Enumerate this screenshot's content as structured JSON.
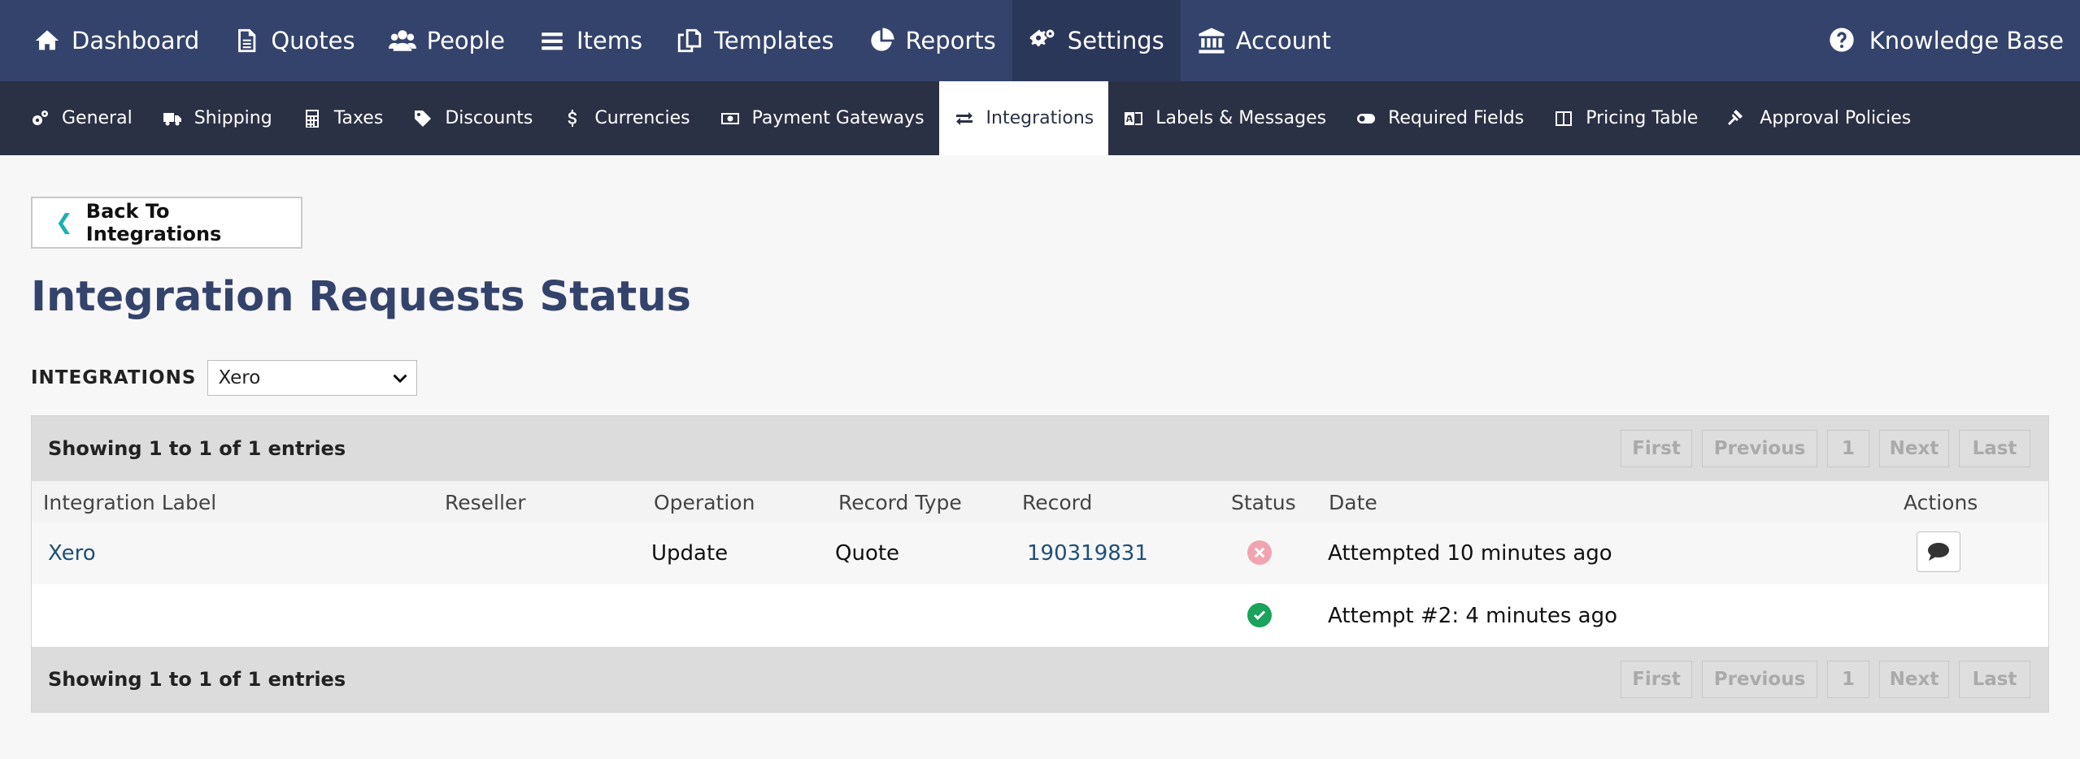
{
  "topnav": {
    "items": [
      {
        "label": "Dashboard",
        "icon": "home-icon"
      },
      {
        "label": "Quotes",
        "icon": "document-icon"
      },
      {
        "label": "People",
        "icon": "users-icon"
      },
      {
        "label": "Items",
        "icon": "list-icon"
      },
      {
        "label": "Templates",
        "icon": "copy-icon"
      },
      {
        "label": "Reports",
        "icon": "pie-chart-icon"
      },
      {
        "label": "Settings",
        "icon": "gears-icon"
      },
      {
        "label": "Account",
        "icon": "bank-icon"
      }
    ],
    "active": "Settings",
    "knowledge_base": "Knowledge Base"
  },
  "subnav": {
    "items": [
      {
        "label": "General",
        "icon": "gears-icon"
      },
      {
        "label": "Shipping",
        "icon": "truck-icon"
      },
      {
        "label": "Taxes",
        "icon": "calculator-icon"
      },
      {
        "label": "Discounts",
        "icon": "tag-icon"
      },
      {
        "label": "Currencies",
        "icon": "dollar-icon"
      },
      {
        "label": "Payment Gateways",
        "icon": "money-icon"
      },
      {
        "label": "Integrations",
        "icon": "exchange-icon"
      },
      {
        "label": "Labels & Messages",
        "icon": "language-icon"
      },
      {
        "label": "Required Fields",
        "icon": "toggle-icon"
      },
      {
        "label": "Pricing Table",
        "icon": "columns-icon"
      },
      {
        "label": "Approval Policies",
        "icon": "gavel-icon"
      }
    ],
    "active": "Integrations"
  },
  "main": {
    "back_label": "Back To Integrations",
    "title": "Integration Requests Status",
    "filter_label": "INTEGRATIONS",
    "filter_value": "Xero"
  },
  "table": {
    "info_top": "Showing 1 to 1 of 1 entries",
    "info_bottom": "Showing 1 to 1 of 1 entries",
    "pager": {
      "first": "First",
      "previous": "Previous",
      "page": "1",
      "next": "Next",
      "last": "Last"
    },
    "columns": {
      "integration_label": "Integration Label",
      "reseller": "Reseller",
      "operation": "Operation",
      "record_type": "Record Type",
      "record": "Record",
      "status": "Status",
      "date": "Date",
      "actions": "Actions"
    },
    "rows": [
      {
        "integration_label": "Xero",
        "reseller": "",
        "operation": "Update",
        "record_type": "Quote",
        "record": "190319831",
        "status": "error",
        "date": "Attempted 10 minutes ago"
      },
      {
        "status": "success",
        "date": "Attempt #2: 4 minutes ago"
      }
    ]
  },
  "colors": {
    "topnav_bg": "#34436b",
    "subnav_bg": "#2b3144",
    "title": "#34436b",
    "error": "#f1a4af",
    "success": "#1aa35a",
    "link": "#1f4f7a"
  }
}
